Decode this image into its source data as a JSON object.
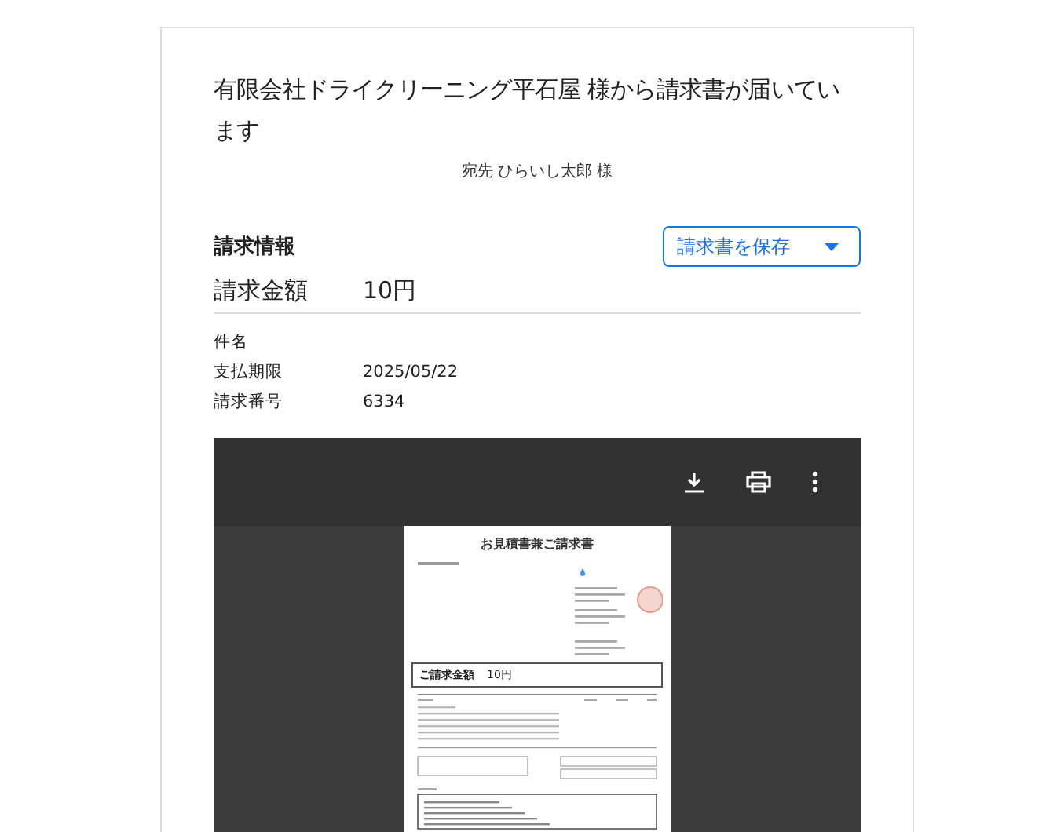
{
  "heading": "有限会社ドライクリーニング平石屋 様から請求書が届いています",
  "recipient": "宛先 ひらいし太郎 様",
  "section_title": "請求情報",
  "save_button": {
    "label": "請求書を保存"
  },
  "amount": {
    "label": "請求金額",
    "value": "10円"
  },
  "details": [
    {
      "label": "件名"
    },
    {
      "label": "支払期限",
      "value": "2025/05/22"
    },
    {
      "label": "請求番号",
      "value": "6334"
    }
  ],
  "document": {
    "title": "お見積書兼ご請求書",
    "amount_label": "ご請求金額",
    "amount_value": "10円"
  }
}
